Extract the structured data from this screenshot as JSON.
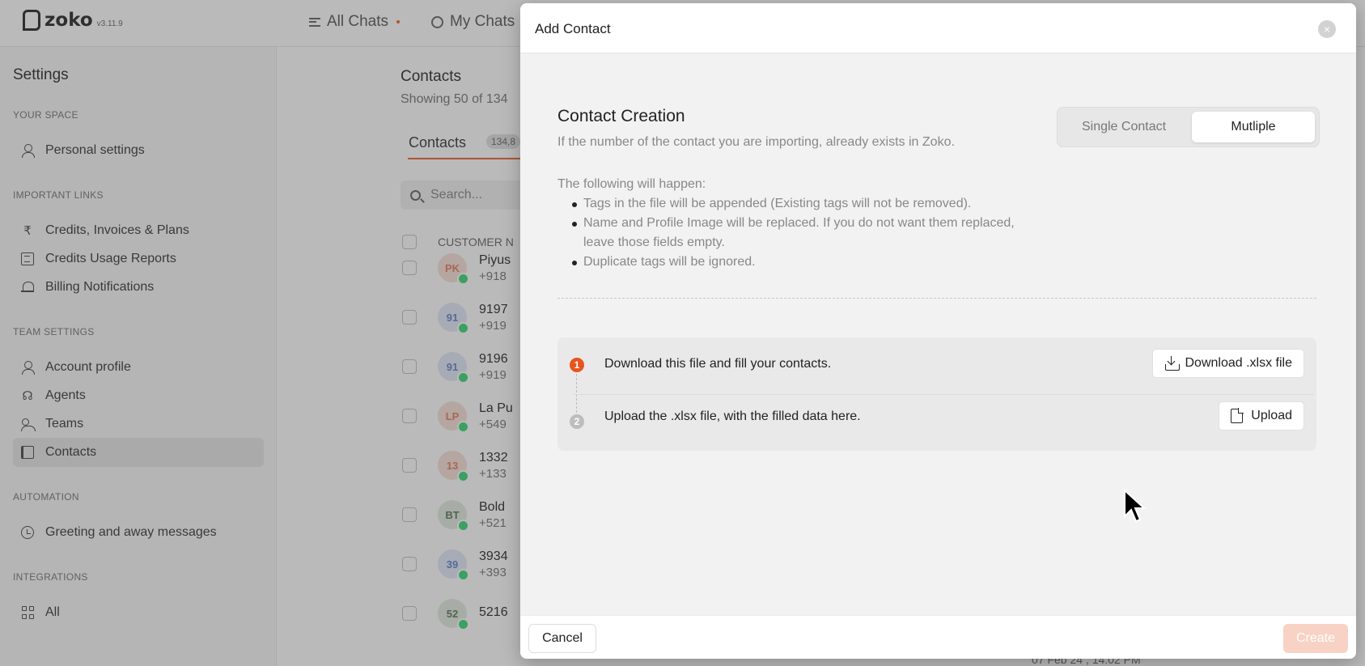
{
  "app": {
    "name": "zoko",
    "version": "v3.11.9"
  },
  "topnav": {
    "all_chats": "All Chats",
    "my_chats": "My Chats"
  },
  "sidebar": {
    "title": "Settings",
    "sections": {
      "your_space": "YOUR SPACE",
      "important_links": "IMPORTANT LINKS",
      "team_settings": "TEAM SETTINGS",
      "automation": "AUTOMATION",
      "integrations": "INTEGRATIONS"
    },
    "items": {
      "personal_settings": "Personal settings",
      "credits_invoices": "Credits, Invoices & Plans",
      "credits_usage": "Credits Usage Reports",
      "billing_notifications": "Billing Notifications",
      "account_profile": "Account profile",
      "agents": "Agents",
      "teams": "Teams",
      "contacts": "Contacts",
      "greeting": "Greeting and away messages",
      "all": "All"
    },
    "active_item": "contacts"
  },
  "contacts_page": {
    "title": "Contacts",
    "subtitle": "Showing 50 of 134",
    "tab_label": "Contacts",
    "tab_count": "134,8",
    "search_placeholder": "Search...",
    "column_customer": "CUSTOMER N",
    "rows": [
      {
        "initials": "PK",
        "name": "Piyus",
        "phone": "+918",
        "bg": "#f6ddd4",
        "fg": "#e07050"
      },
      {
        "initials": "91",
        "name": "9197",
        "phone": "+919",
        "bg": "#dde6f6",
        "fg": "#5577c0"
      },
      {
        "initials": "91",
        "name": "9196",
        "phone": "+919",
        "bg": "#dde6f6",
        "fg": "#5577c0"
      },
      {
        "initials": "LP",
        "name": "La Pu",
        "phone": "+549",
        "bg": "#f6ddd4",
        "fg": "#e07050"
      },
      {
        "initials": "13",
        "name": "1332",
        "phone": "+133",
        "bg": "#f6ddd4",
        "fg": "#e07050"
      },
      {
        "initials": "BT",
        "name": "Bold",
        "phone": "+521",
        "bg": "#dfe8dc",
        "fg": "#4a6a4a"
      },
      {
        "initials": "39",
        "name": "3934",
        "phone": "+393",
        "bg": "#dde6f6",
        "fg": "#5577c0"
      },
      {
        "initials": "52",
        "name": "5216",
        "phone": "",
        "bg": "#dfe8dc",
        "fg": "#4a6a4a"
      }
    ],
    "date_peek": "07 Feb 24 , 14:02 PM"
  },
  "modal": {
    "title": "Add Contact",
    "close_icon": "×",
    "heading": "Contact Creation",
    "subheading": "If the number of the contact you are importing, already exists in Zoko.",
    "toggle": {
      "single": "Single Contact",
      "multiple": "Mutliple",
      "selected": "multiple"
    },
    "following_intro": "The following will happen:",
    "bullets": {
      "b1": "Tags in the file will be appended (Existing tags will not be removed).",
      "b2a": "Name and Profile Image will be replaced. If you do not want them replaced,",
      "b2b": "leave those fields empty.",
      "b3": "Duplicate tags will be ignored."
    },
    "steps": {
      "step1_num": "1",
      "step1_text": "Download this file and fill your contacts.",
      "step1_button": "Download .xlsx file",
      "step2_num": "2",
      "step2_text": "Upload the .xlsx file, with the filled data here.",
      "step2_button": "Upload"
    },
    "footer": {
      "cancel": "Cancel",
      "create": "Create"
    }
  },
  "colors": {
    "accent": "#e8541e",
    "create_disabled": "#f8d2c4",
    "overlay": "rgba(90,90,90,0.42)"
  }
}
